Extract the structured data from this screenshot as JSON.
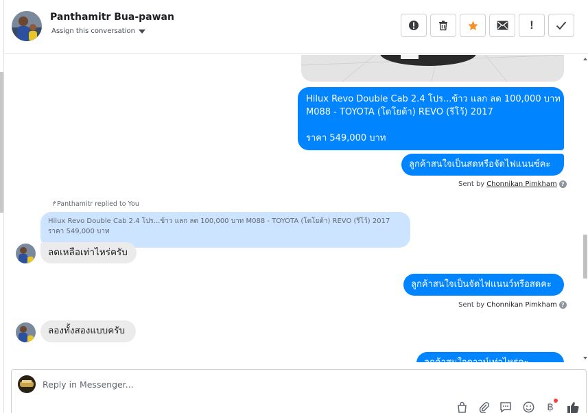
{
  "header": {
    "contact_name": "Panthamitr Bua-pawan",
    "assign_label": "Assign this conversation",
    "toolbar": [
      {
        "icon": "alert-circle-icon",
        "label": "!"
      },
      {
        "icon": "trash-icon"
      },
      {
        "icon": "star-icon",
        "color": "#f5922e"
      },
      {
        "icon": "envelope-icon"
      },
      {
        "icon": "exclamation-icon",
        "label": "!"
      },
      {
        "icon": "check-icon"
      }
    ]
  },
  "messages": {
    "car_card": {
      "line1": "Hilux Revo Double Cab 2.4 โปร...ข้าว แลก ลด 100,000 บาท",
      "line2": "M088 - TOYOTA (โตโยต้า) REVO (รีโว้) 2017",
      "price": "ราคา 549,000 บาท"
    },
    "out_1": "ลูกค้าสนใจเป็นสดหรือจัดไฟแนนซ์คะ",
    "sent_by_1": {
      "prefix": "Sent by",
      "name": "Chonnikan Pimkham"
    },
    "replied_label": "Panthamitr replied to You",
    "quote": "Hilux Revo Double Cab 2.4 โปร...ข้าว แลก ลด 100,000 บาท M088 - TOYOTA (โตโยต้า) REVO (รีโว้) 2017 ราคา 549,000 บาท",
    "in_1": "ลดเหลือเท่าไหร่ครับ",
    "out_2": "ลูกค้าสนใจเป็นจัดไฟแนนว์หรือสดคะ",
    "sent_by_2": {
      "prefix": "Sent by",
      "name": "Chonnikan Pimkham"
    },
    "in_2": "ลองทั้งสองแบบครับ",
    "out_3_partial": "ลูกค้าสนใจดาวน์เท่าไหร่คะ"
  },
  "composer": {
    "placeholder": "Reply in Messenger...",
    "icons": [
      "shopping-bag-icon",
      "paperclip-icon",
      "saved-replies-icon",
      "emoji-icon",
      "baht-payment-icon",
      "thumbs-up-icon"
    ]
  },
  "colors": {
    "messenger_blue": "#0084ff",
    "incoming_gray": "#ebebeb",
    "quote_blue": "#cce4ff",
    "star_orange": "#f5922e",
    "notification_dot": "#fa3e3e"
  }
}
